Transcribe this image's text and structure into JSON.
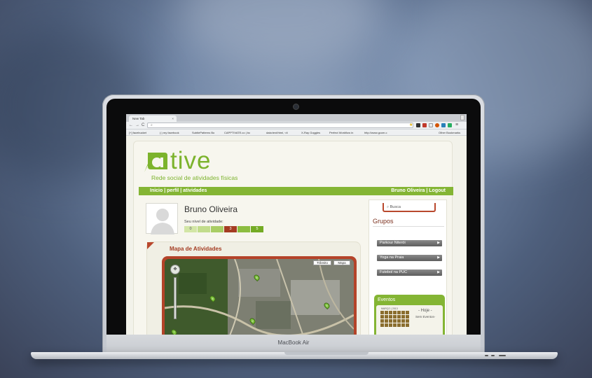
{
  "device": {
    "label": "MacBook Air"
  },
  "browser": {
    "tab_title": "New Tab",
    "tab_close": "×",
    "nav": {
      "back": "←",
      "forward": "→",
      "reload": "C"
    },
    "bookmarks": [
      "[+] facebucket",
      "(:) my facebook",
      "SubtlePatterns Bo",
      "CAPPTIVATE.co | bc",
      "data:text/html, <ti",
      "X-Ray Goggles",
      "Perfect Workflow in",
      "http://www.gcom.c",
      "Other Bookmarks"
    ]
  },
  "site": {
    "logo_letter": "a",
    "logo_text": "tive",
    "tagline": "Rede social de atividades físicas",
    "nav": {
      "inicio": "Inicio",
      "perfil": "perfil",
      "atividades": "atividades",
      "sep": " | "
    },
    "user_menu": "Bruno Oliveira | Logout"
  },
  "profile": {
    "name": "Bruno Oliveira",
    "level_label": "Seu nível de atividade:",
    "level_scale": [
      "0",
      "",
      "",
      "3",
      "",
      "5"
    ],
    "current_level": 3
  },
  "map": {
    "title": "Mapa de Atividades",
    "btn_traffic": "Trânsito",
    "btn_map": "Mapa",
    "pins": [
      "8",
      "4",
      "5",
      "2",
      "7"
    ]
  },
  "sidebar": {
    "search_placeholder": "Busca",
    "groups_title": "Grupos",
    "groups": [
      "Parkour Niterói",
      "Yoga na Praia",
      "Futebol na PUC"
    ],
    "events_title": "Eventos",
    "calendar_month": "MARÇO | 2013",
    "today": "- Hoje -",
    "no_events": "Sem Eventos-"
  },
  "colors": {
    "brand_green": "#84b534",
    "accent_red": "#b44329"
  }
}
